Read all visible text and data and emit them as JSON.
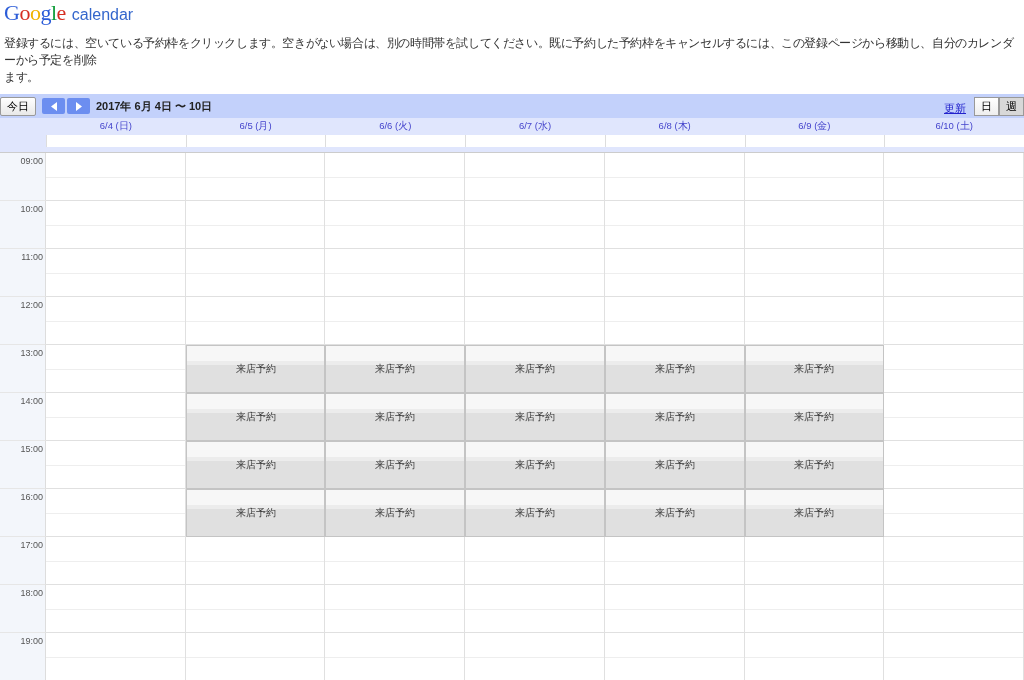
{
  "logo": {
    "brand": "Google",
    "product": "calendar"
  },
  "instructions": [
    "登録するには、空いている予約枠をクリックします。空きがない場合は、別の時間帯を試してください。既に予約した予約枠をキャンセルするには、この登録ページから移動し、自分のカレンダーから予定を削除",
    "ます。"
  ],
  "toolbar": {
    "today": "今日",
    "range": "2017年 6月 4日 〜 10日",
    "refresh": "更新",
    "views": [
      {
        "label": "日",
        "selected": false
      },
      {
        "label": "週",
        "selected": true
      }
    ]
  },
  "days": [
    "6/4 (日)",
    "6/5 (月)",
    "6/6 (火)",
    "6/7 (水)",
    "6/8 (木)",
    "6/9 (金)",
    "6/10 (土)"
  ],
  "hours": [
    {
      "time": "09:00",
      "cells": [
        {
          "kind": "empty"
        },
        {
          "kind": "empty"
        },
        {
          "kind": "empty"
        },
        {
          "kind": "empty"
        },
        {
          "kind": "empty"
        },
        {
          "kind": "empty"
        },
        {
          "kind": "empty"
        }
      ]
    },
    {
      "time": "10:00",
      "cells": [
        {
          "kind": "empty"
        },
        {
          "kind": "empty"
        },
        {
          "kind": "empty"
        },
        {
          "kind": "empty"
        },
        {
          "kind": "empty"
        },
        {
          "kind": "empty"
        },
        {
          "kind": "empty"
        }
      ]
    },
    {
      "time": "11:00",
      "cells": [
        {
          "kind": "empty"
        },
        {
          "kind": "empty"
        },
        {
          "kind": "empty"
        },
        {
          "kind": "empty"
        },
        {
          "kind": "empty"
        },
        {
          "kind": "empty"
        },
        {
          "kind": "empty"
        }
      ]
    },
    {
      "time": "12:00",
      "cells": [
        {
          "kind": "empty"
        },
        {
          "kind": "empty"
        },
        {
          "kind": "empty"
        },
        {
          "kind": "empty"
        },
        {
          "kind": "empty"
        },
        {
          "kind": "empty"
        },
        {
          "kind": "empty"
        }
      ]
    },
    {
      "time": "13:00",
      "cells": [
        {
          "kind": "empty"
        },
        {
          "kind": "slot",
          "label": "来店予約"
        },
        {
          "kind": "slot",
          "label": "来店予約"
        },
        {
          "kind": "slot",
          "label": "来店予約"
        },
        {
          "kind": "slot",
          "label": "来店予約"
        },
        {
          "kind": "slot",
          "label": "来店予約"
        },
        {
          "kind": "empty"
        }
      ]
    },
    {
      "time": "14:00",
      "cells": [
        {
          "kind": "empty"
        },
        {
          "kind": "slot",
          "label": "来店予約"
        },
        {
          "kind": "slot",
          "label": "来店予約"
        },
        {
          "kind": "slot",
          "label": "来店予約"
        },
        {
          "kind": "slot",
          "label": "来店予約"
        },
        {
          "kind": "slot",
          "label": "来店予約"
        },
        {
          "kind": "empty"
        }
      ]
    },
    {
      "time": "15:00",
      "cells": [
        {
          "kind": "empty"
        },
        {
          "kind": "slot",
          "label": "来店予約"
        },
        {
          "kind": "slot",
          "label": "来店予約"
        },
        {
          "kind": "slot",
          "label": "来店予約"
        },
        {
          "kind": "slot",
          "label": "来店予約"
        },
        {
          "kind": "slot",
          "label": "来店予約"
        },
        {
          "kind": "empty"
        }
      ]
    },
    {
      "time": "16:00",
      "cells": [
        {
          "kind": "empty"
        },
        {
          "kind": "slot",
          "label": "来店予約"
        },
        {
          "kind": "slot",
          "label": "来店予約"
        },
        {
          "kind": "slot",
          "label": "来店予約"
        },
        {
          "kind": "slot",
          "label": "来店予約"
        },
        {
          "kind": "slot",
          "label": "来店予約"
        },
        {
          "kind": "empty"
        }
      ]
    },
    {
      "time": "17:00",
      "cells": [
        {
          "kind": "empty"
        },
        {
          "kind": "empty"
        },
        {
          "kind": "empty"
        },
        {
          "kind": "empty"
        },
        {
          "kind": "empty"
        },
        {
          "kind": "empty"
        },
        {
          "kind": "empty"
        }
      ]
    },
    {
      "time": "18:00",
      "cells": [
        {
          "kind": "empty"
        },
        {
          "kind": "empty"
        },
        {
          "kind": "empty"
        },
        {
          "kind": "empty"
        },
        {
          "kind": "empty"
        },
        {
          "kind": "empty"
        },
        {
          "kind": "empty"
        }
      ]
    },
    {
      "time": "19:00",
      "cells": [
        {
          "kind": "empty"
        },
        {
          "kind": "empty"
        },
        {
          "kind": "empty"
        },
        {
          "kind": "empty"
        },
        {
          "kind": "empty"
        },
        {
          "kind": "empty"
        },
        {
          "kind": "empty"
        }
      ]
    }
  ]
}
